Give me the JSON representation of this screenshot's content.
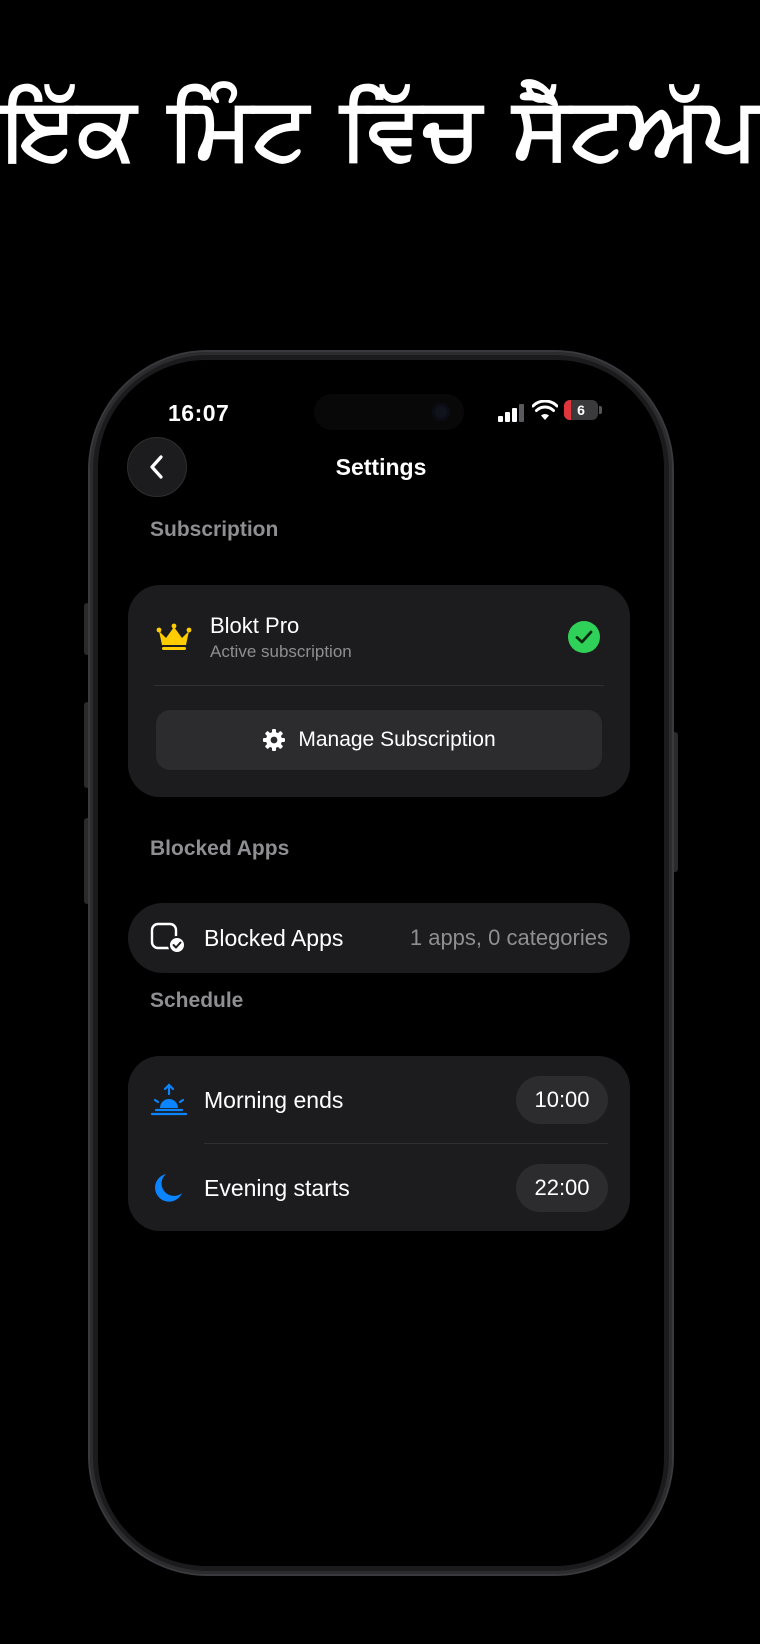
{
  "headline": "ਇੱਕ ਮਿੰਟ ਵਿੱਚ ਸੈੱਟਅੱਪ",
  "status_bar": {
    "time": "16:07",
    "battery": "6"
  },
  "nav": {
    "title": "Settings",
    "back_icon": "chevron-left-icon"
  },
  "subscription": {
    "section_label": "Subscription",
    "plan_name": "Blokt Pro",
    "plan_status": "Active subscription",
    "plan_icon": "crown-icon",
    "status_icon": "checkmark-circle-icon",
    "manage_label": "Manage Subscription",
    "manage_icon": "gear-icon"
  },
  "blocked_apps": {
    "section_label": "Blocked Apps",
    "row_label": "Blocked Apps",
    "row_value": "1 apps, 0 categories",
    "icon": "app-blocked-icon"
  },
  "schedule": {
    "section_label": "Schedule",
    "items": [
      {
        "label": "Morning ends",
        "time": "10:00",
        "icon": "sunrise-icon"
      },
      {
        "label": "Evening starts",
        "time": "22:00",
        "icon": "moon-icon"
      }
    ]
  },
  "colors": {
    "background": "#000000",
    "card": "#1c1c1e",
    "secondary_text": "#8e8e93",
    "accent_green": "#30d158",
    "accent_blue": "#0a84ff",
    "crown_yellow": "#ffcc00",
    "battery_low": "#e0353a"
  }
}
